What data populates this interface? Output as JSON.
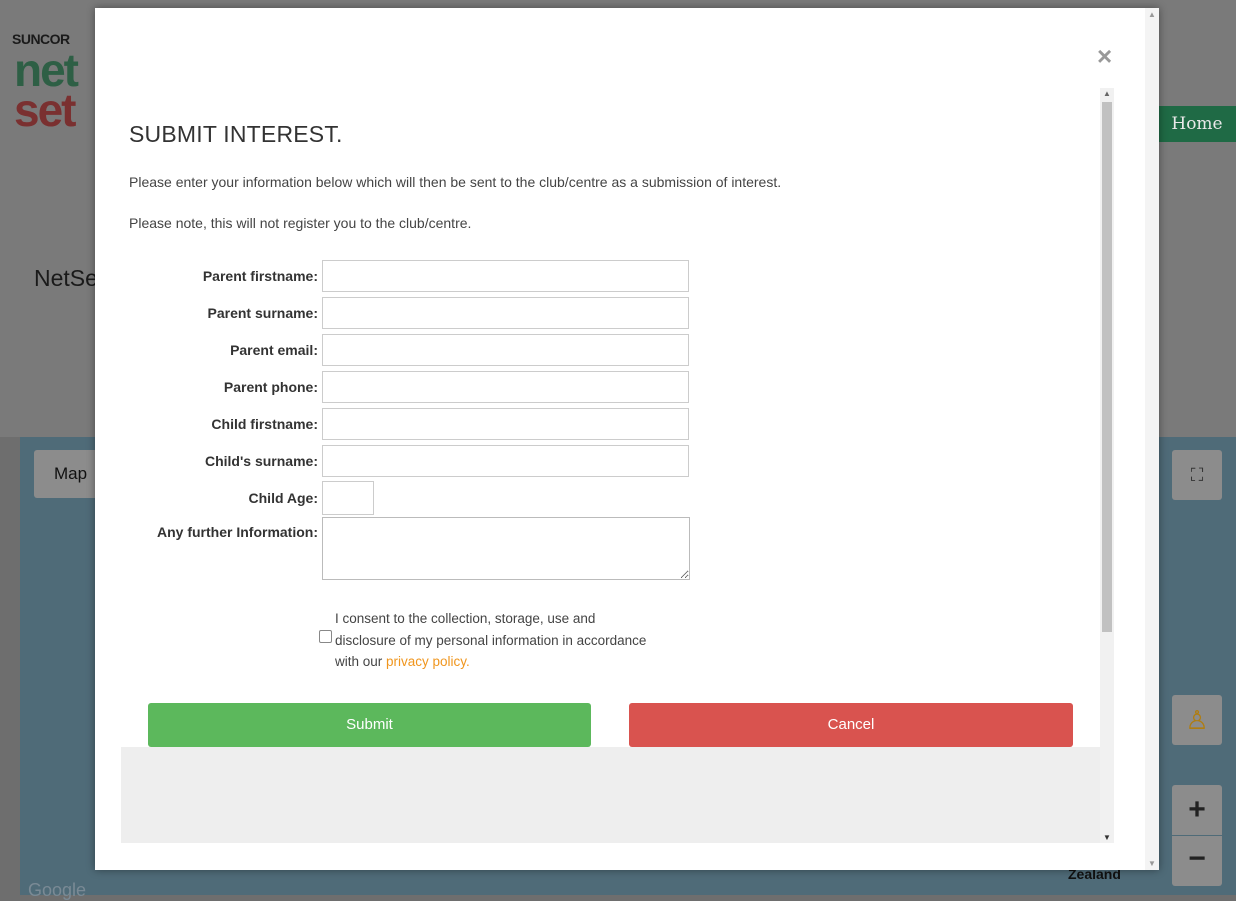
{
  "background": {
    "brand_top": "SUNCOR",
    "brand_net": "net",
    "brand_set": "set",
    "home_label": "Home",
    "page_heading": "NetSe",
    "map_button_label": "Map",
    "map_region_label": "Zealand",
    "map_attribution": "Google"
  },
  "modal": {
    "title": "SUBMIT INTEREST.",
    "intro_line1": "Please enter your information below which will then be sent to the club/centre as a submission of interest.",
    "intro_line2": "Please note, this will not register you to the club/centre.",
    "fields": {
      "parent_firstname": {
        "label": "Parent firstname:",
        "value": ""
      },
      "parent_surname": {
        "label": "Parent surname:",
        "value": ""
      },
      "parent_email": {
        "label": "Parent email:",
        "value": ""
      },
      "parent_phone": {
        "label": "Parent phone:",
        "value": ""
      },
      "child_firstname": {
        "label": "Child firstname:",
        "value": ""
      },
      "child_surname": {
        "label": "Child's surname:",
        "value": ""
      },
      "child_age": {
        "label": "Child Age:",
        "value": ""
      },
      "further_info": {
        "label": "Any further Information:",
        "value": ""
      }
    },
    "consent": {
      "text_before": "I consent to the collection, storage, use and disclosure of my personal information in accordance with our ",
      "link_text": "privacy policy.",
      "checked": false
    },
    "submit_label": "Submit",
    "cancel_label": "Cancel"
  },
  "colors": {
    "submit": "#5cb85c",
    "cancel": "#d9534f",
    "link": "#f0961e"
  }
}
